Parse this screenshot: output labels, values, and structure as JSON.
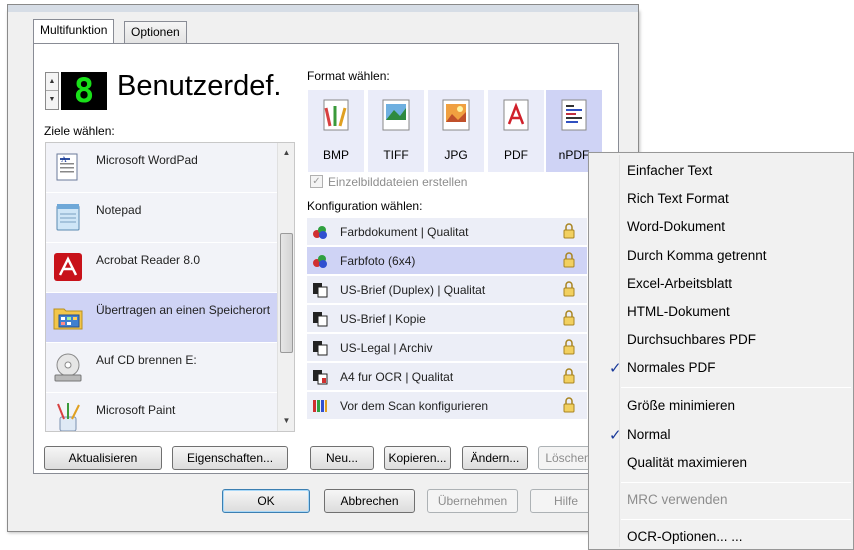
{
  "tabs": [
    {
      "label": "Multifunktion",
      "active": true
    },
    {
      "label": "Optionen",
      "active": false
    }
  ],
  "profile": {
    "led_digit": "8",
    "name": "Benutzerdef."
  },
  "destinations": {
    "label": "Ziele wählen:",
    "items": [
      {
        "label": "Microsoft WordPad",
        "icon": "wordpad-icon",
        "selected": false
      },
      {
        "label": "Notepad",
        "icon": "notepad-icon",
        "selected": false
      },
      {
        "label": "Acrobat Reader 8.0",
        "icon": "acrobat-icon",
        "selected": false
      },
      {
        "label": "Übertragen an einen Speicherort",
        "icon": "folder-icon",
        "selected": true
      },
      {
        "label": "Auf CD brennen  E:",
        "icon": "cd-drive-icon",
        "selected": false
      },
      {
        "label": "Microsoft Paint",
        "icon": "paint-icon",
        "selected": false
      }
    ],
    "buttons": {
      "refresh": "Aktualisieren",
      "properties": "Eigenschaften..."
    }
  },
  "format": {
    "label": "Format wählen:",
    "items": [
      {
        "label": "BMP",
        "icon": "bmp-icon",
        "selected": false
      },
      {
        "label": "TIFF",
        "icon": "tiff-icon",
        "selected": false
      },
      {
        "label": "JPG",
        "icon": "jpg-icon",
        "selected": false
      },
      {
        "label": "PDF",
        "icon": "pdf-icon",
        "selected": false
      },
      {
        "label": "nPDF",
        "icon": "npdf-icon",
        "selected": true
      }
    ],
    "single_files_label": "Einzelbilddateien erstellen",
    "single_files_checked": true
  },
  "configuration": {
    "label": "Konfiguration wählen:",
    "items": [
      {
        "label": "Farbdokument | Qualitat",
        "icon": "color-doc-icon",
        "selected": false
      },
      {
        "label": "Farbfoto (6x4)",
        "icon": "color-photo-icon",
        "selected": true
      },
      {
        "label": "US-Brief (Duplex) | Qualitat",
        "icon": "bw-doc-icon",
        "selected": false
      },
      {
        "label": "US-Brief | Kopie",
        "icon": "bw-doc-icon",
        "selected": false
      },
      {
        "label": "US-Legal | Archiv",
        "icon": "bw-doc-icon",
        "selected": false
      },
      {
        "label": "A4 fur OCR | Qualitat",
        "icon": "bw-doc-icon",
        "selected": false
      },
      {
        "label": "Vor dem Scan konfigurieren",
        "icon": "configure-icon",
        "selected": false
      }
    ],
    "buttons": {
      "new": "Neu...",
      "copy": "Kopieren...",
      "edit": "Ändern...",
      "delete": "Löschen"
    }
  },
  "footer": {
    "ok": "OK",
    "cancel": "Abbrechen",
    "apply": "Übernehmen",
    "help": "Hilfe"
  },
  "menu": {
    "items": [
      {
        "label": "Einfacher Text",
        "checked": false,
        "disabled": false
      },
      {
        "label": "Rich Text Format",
        "checked": false,
        "disabled": false
      },
      {
        "label": "Word-Dokument",
        "checked": false,
        "disabled": false
      },
      {
        "label": "Durch Komma getrennt",
        "checked": false,
        "disabled": false
      },
      {
        "label": "Excel-Arbeitsblatt",
        "checked": false,
        "disabled": false
      },
      {
        "label": "HTML-Dokument",
        "checked": false,
        "disabled": false
      },
      {
        "label": "Durchsuchbares PDF",
        "checked": false,
        "disabled": false
      },
      {
        "label": "Normales PDF",
        "checked": true,
        "disabled": false
      },
      {
        "label": "Größe minimieren",
        "checked": false,
        "disabled": false
      },
      {
        "label": "Normal",
        "checked": true,
        "disabled": false
      },
      {
        "label": "Qualität maximieren",
        "checked": false,
        "disabled": false
      },
      {
        "label": "MRC verwenden",
        "checked": false,
        "disabled": true
      },
      {
        "label": "OCR-Optionen... ...",
        "checked": false,
        "disabled": false
      }
    ],
    "check_glyph": "✓"
  },
  "colors": {
    "selection": "#cfd3f5",
    "item_bg": "#eceef7",
    "led": "#19e019",
    "check": "#1a3a9a"
  }
}
